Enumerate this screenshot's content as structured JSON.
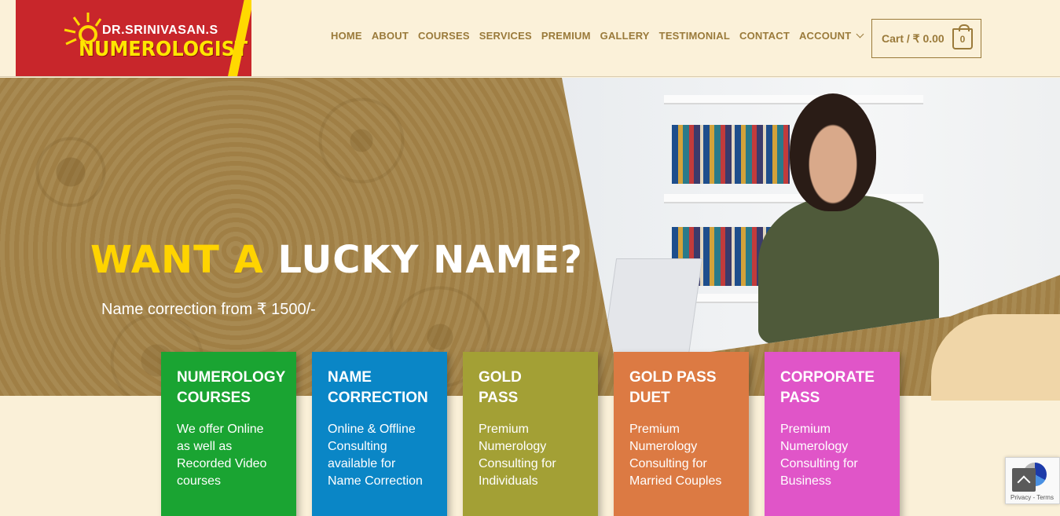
{
  "brand": {
    "line1": "DR.SRINIVASAN.S",
    "line2": "NUMEROLOGIST"
  },
  "nav": [
    {
      "label": "HOME"
    },
    {
      "label": "ABOUT"
    },
    {
      "label": "COURSES"
    },
    {
      "label": "SERVICES"
    },
    {
      "label": "PREMIUM"
    },
    {
      "label": "GALLERY"
    },
    {
      "label": "TESTIMONIAL"
    },
    {
      "label": "CONTACT"
    },
    {
      "label": "ACCOUNT"
    }
  ],
  "cart": {
    "label": "Cart / ₹ 0.00",
    "count": "0"
  },
  "hero": {
    "title_highlight": "WANT A",
    "title_rest": "LUCKY NAME?",
    "subtitle": "Name correction from ₹ 1500/-"
  },
  "cards": [
    {
      "title": "NUMEROLOGY\nCOURSES",
      "text": "We offer Online\nas well as\nRecorded Video\ncourses",
      "color": "#1aa432"
    },
    {
      "title": "NAME\nCORRECTION",
      "text": "Online & Offline\nConsulting\navailable for\nName Correction",
      "color": "#0a86c6"
    },
    {
      "title": "GOLD\nPASS",
      "text": "Premium\nNumerology\nConsulting for\nIndividuals",
      "color": "#a3a035"
    },
    {
      "title": "GOLD PASS\nDUET",
      "text": "Premium\nNumerology\nConsulting for\nMarried Couples",
      "color": "#dc7a43"
    },
    {
      "title": "CORPORATE\nPASS",
      "text": "Premium\nNumerology\nConsulting for\nBusiness",
      "color": "#e055c8"
    }
  ],
  "recaptcha": {
    "terms": "Privacy - Terms"
  },
  "icons": {
    "account_dropdown": "chevron-down-icon",
    "cart": "shopping-bag-icon",
    "scroll_top": "chevron-up-icon"
  }
}
